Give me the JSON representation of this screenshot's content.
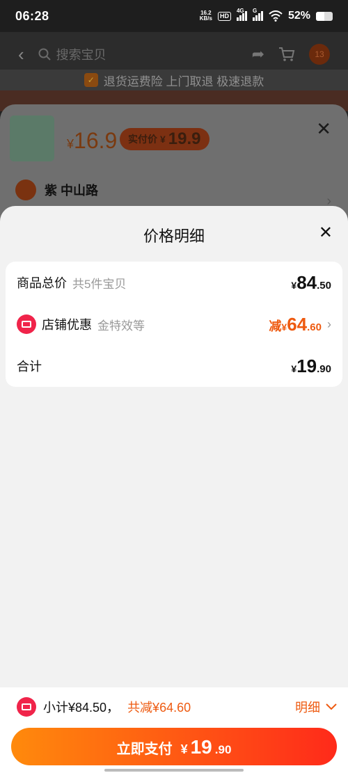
{
  "status_bar": {
    "time": "06:28",
    "net_speed_value": "16.2",
    "net_speed_unit": "KB/s",
    "hd": "HD",
    "network_1": "4G",
    "network_2": "G",
    "battery": "52%"
  },
  "background": {
    "search_placeholder": "搜索宝贝",
    "cart_badge": "13",
    "notice": "退货运费险 上门取退 极速退款",
    "product_price_currency": "¥",
    "product_price": "16.9",
    "paid_price_label": "实付价",
    "paid_price_currency": "¥",
    "paid_price": "19.9",
    "address": "紫 中山路"
  },
  "price_detail": {
    "title": "价格明细",
    "rows": [
      {
        "label": "商品总价",
        "sub": "共5件宝贝",
        "prefix": "",
        "currency": "¥",
        "integer": "84",
        "decimal": ".50"
      },
      {
        "label": "店铺优惠",
        "sub": "金特效等",
        "prefix": "减",
        "currency": "¥",
        "integer": "64",
        "decimal": ".60"
      },
      {
        "label": "合计",
        "sub": "",
        "prefix": "",
        "currency": "¥",
        "integer": "19",
        "decimal": ".90"
      }
    ]
  },
  "bottom_bar": {
    "subtotal_text": "小计¥84.50，",
    "discount_text": "共减¥64.60",
    "detail_label": "明细",
    "pay_label": "立即支付",
    "pay_currency": "¥",
    "pay_integer": "19",
    "pay_decimal": ".90"
  },
  "colors": {
    "accent_orange": "#ee5a10",
    "shop_red": "#f0244a",
    "pay_gradient_start": "#ff8a0c",
    "pay_gradient_end": "#ff2a1a"
  }
}
